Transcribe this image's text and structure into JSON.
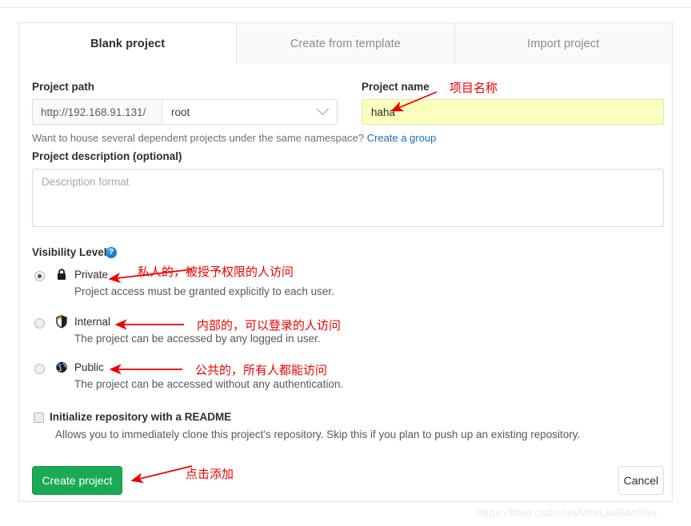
{
  "tabs": [
    {
      "label": "Blank project",
      "active": true
    },
    {
      "label": "Create from template",
      "active": false
    },
    {
      "label": "Import project",
      "active": false
    }
  ],
  "form": {
    "project_path": {
      "label": "Project path",
      "prefix": "http://192.168.91.131/",
      "namespace_value": "root"
    },
    "namespace_hint": {
      "text": "Want to house several dependent projects under the same namespace?",
      "link_label": "Create a group"
    },
    "project_name": {
      "label": "Project name",
      "value": "haha"
    },
    "project_description": {
      "label": "Project description (optional)",
      "placeholder": "Description format"
    },
    "visibility": {
      "label": "Visibility Level",
      "help_icon": "?",
      "options": [
        {
          "name": "Private",
          "icon": "lock-icon",
          "description": "Project access must be granted explicitly to each user.",
          "selected": true
        },
        {
          "name": "Internal",
          "icon": "shield-icon",
          "description": "The project can be accessed by any logged in user.",
          "selected": false
        },
        {
          "name": "Public",
          "icon": "globe-icon",
          "description": "The project can be accessed without any authentication.",
          "selected": false
        }
      ]
    },
    "readme": {
      "label": "Initialize repository with a README",
      "description": "Allows you to immediately clone this project's repository. Skip this if you plan to push up an existing repository.",
      "checked": false
    },
    "create_button": "Create project",
    "cancel_button": "Cancel"
  },
  "annotations": {
    "project_name": "项目名称",
    "private": "私人的，被授予权限的人访问",
    "internal": "内部的，可以登录的人访问",
    "public": "公共的，所有人都能访问",
    "create": "点击添加"
  },
  "colors": {
    "accent_tab": "#6b66c9",
    "create_button": "#1aaa55",
    "annotation_red": "#ef0000",
    "name_field_highlight": "#faffbd",
    "link_blue": "#1b69b6"
  },
  "watermark": "https://blog.csdn.net/WanJiaBaoBao"
}
